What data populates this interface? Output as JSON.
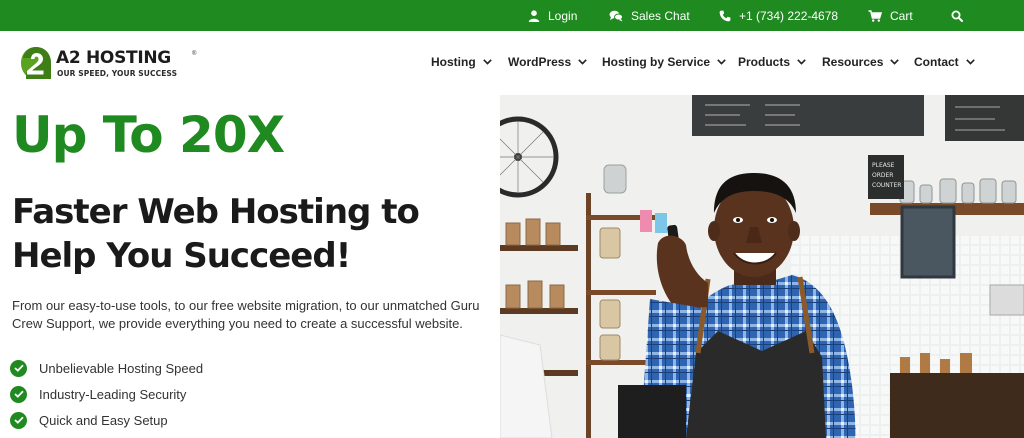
{
  "topbar": {
    "login": "Login",
    "chat": "Sales Chat",
    "phone": "+1 (734) 222-4678",
    "cart": "Cart",
    "bg_color": "#1f8a1f",
    "icons": [
      "user-icon",
      "chat-bubbles-icon",
      "phone-icon",
      "cart-icon",
      "search-icon"
    ]
  },
  "logo": {
    "name": "A2 HOSTING",
    "tagline": "OUR SPEED, YOUR SUCCESS",
    "reg": "®"
  },
  "nav": {
    "items": [
      "Hosting",
      "WordPress",
      "Hosting by Service",
      "Products",
      "Resources",
      "Contact"
    ]
  },
  "hero": {
    "headline": "Up To 20X",
    "subheadline": "Faster Web Hosting to Help You Succeed!",
    "description": "From our easy-to-use tools, to our free website migration, to our unmatched Guru Crew Support, we provide everything you need to create a successful website.",
    "features": [
      "Unbelievable Hosting Speed",
      "Industry-Leading Security",
      "Quick and Easy Setup"
    ],
    "accent_color": "#1f8a1f"
  },
  "photo": {
    "sign_text": "PLEASE ORDER AT COUNTER"
  }
}
